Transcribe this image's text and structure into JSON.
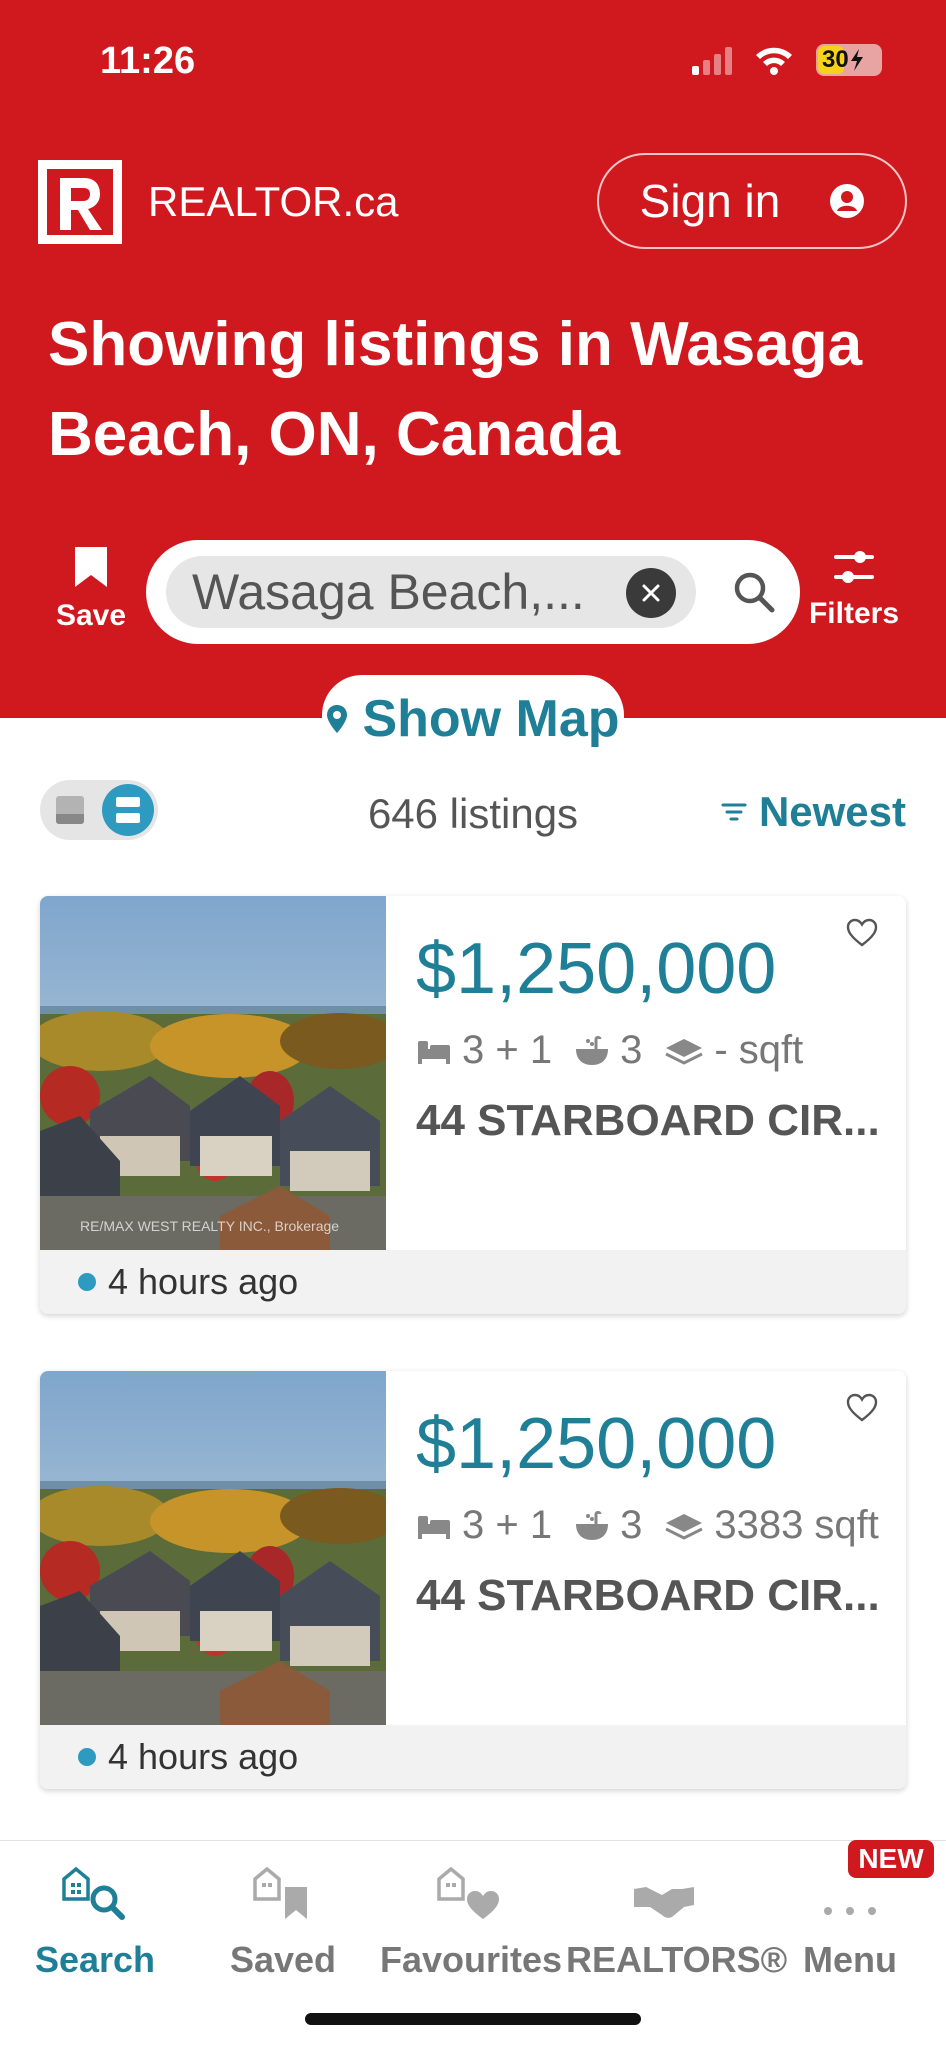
{
  "status_bar": {
    "time": "11:26",
    "battery": "30"
  },
  "header": {
    "brand": "REALTOR.ca",
    "sign_in": "Sign in",
    "headline": "Showing listings in Wasaga Beach, ON, Canada",
    "save_label": "Save",
    "filters_label": "Filters",
    "search_value": "Wasaga Beach,..."
  },
  "show_map_label": "Show Map",
  "toolbar": {
    "count": "646 listings",
    "sort": "Newest"
  },
  "listings": [
    {
      "price": "$1,250,000",
      "beds": "3 + 1",
      "baths": "3",
      "sqft": "- sqft",
      "address": "44 STARBOARD CIR...",
      "time": "4 hours ago",
      "watermark": "RE/MAX WEST REALTY INC., Brokerage"
    },
    {
      "price": "$1,250,000",
      "beds": "3 + 1",
      "baths": "3",
      "sqft": "3383 sqft",
      "address": "44 STARBOARD CIR...",
      "time": "4 hours ago"
    }
  ],
  "tabs": [
    "Search",
    "Saved",
    "Favourites",
    "REALTORS®",
    "Menu"
  ],
  "new_badge": "NEW",
  "colors": {
    "brand_red": "#d0191f",
    "accent_teal": "#1f7f96",
    "dot_blue": "#2f9ac0"
  }
}
